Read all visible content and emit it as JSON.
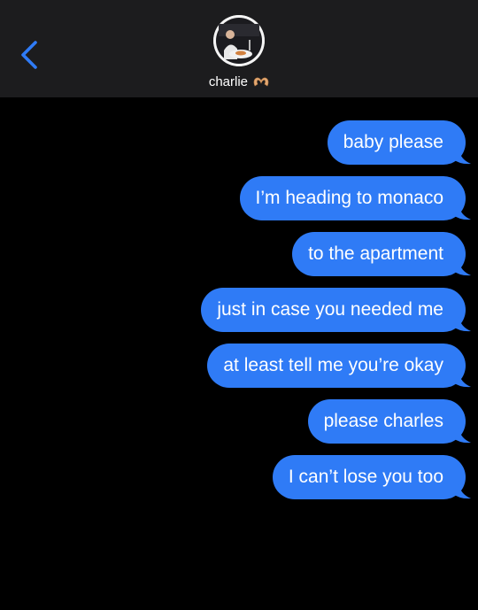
{
  "header": {
    "back_icon": "chevron-left-icon",
    "contact_name": "charlie",
    "contact_emoji_icon": "heart-hands-icon",
    "accent_color": "#2f7bf6"
  },
  "messages": [
    {
      "text": "baby please",
      "from": "me"
    },
    {
      "text": "I’m heading to monaco",
      "from": "me"
    },
    {
      "text": "to the apartment",
      "from": "me"
    },
    {
      "text": "just in case you needed me",
      "from": "me"
    },
    {
      "text": "at least tell me you’re okay",
      "from": "me"
    },
    {
      "text": "please charles",
      "from": "me"
    },
    {
      "text": "I can’t lose you too",
      "from": "me"
    }
  ],
  "colors": {
    "outgoing_bubble": "#2f7bf6",
    "header_bg": "#1c1c1e",
    "background": "#000000"
  }
}
